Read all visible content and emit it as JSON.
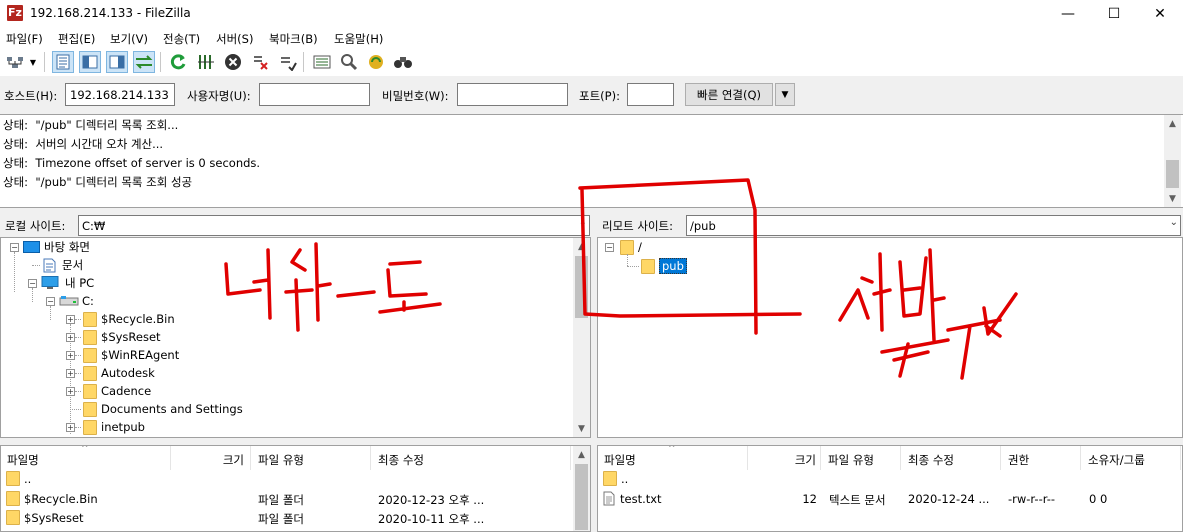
{
  "window": {
    "title": "192.168.214.133 - FileZilla",
    "app_icon": "Fz",
    "controls": {
      "minimize": "—",
      "maximize": "☐",
      "close": "✕"
    }
  },
  "menu": [
    "파일(F)",
    "편집(E)",
    "보기(V)",
    "전송(T)",
    "서버(S)",
    "북마크(B)",
    "도움말(H)"
  ],
  "toolbar": {
    "icons": [
      "site-manager-icon",
      "dropdown-arrow-icon",
      "toggle-log-icon",
      "toggle-local-tree-icon",
      "toggle-remote-tree-icon",
      "toggle-queue-icon",
      "refresh-icon",
      "process-queue-icon",
      "cancel-icon",
      "disconnect-icon",
      "reconnect-icon",
      "filter-icon",
      "compare-icon",
      "sync-browse-icon",
      "search-icon"
    ]
  },
  "quickconnect": {
    "host_label": "호스트(H):",
    "host_value": "192.168.214.133",
    "user_label": "사용자명(U):",
    "user_value": "",
    "pass_label": "비밀번호(W):",
    "pass_value": "",
    "port_label": "포트(P):",
    "port_value": "",
    "button": "빠른 연결(Q)",
    "dropdown": "▼"
  },
  "log": [
    {
      "prefix": "상태:",
      "text": "\"/pub\" 디렉터리 목록 조회..."
    },
    {
      "prefix": "상태:",
      "text": "서버의 시간대 오차 계산..."
    },
    {
      "prefix": "상태:",
      "text": "Timezone offset of server is 0 seconds."
    },
    {
      "prefix": "상태:",
      "text": "\"/pub\" 디렉터리 목록 조회 성공"
    }
  ],
  "local": {
    "site_label": "로컬 사이트:",
    "path": "C:₩",
    "tree": [
      {
        "label": "바탕 화면",
        "icon": "desktop-icon"
      },
      {
        "label": "문서",
        "icon": "document-icon"
      },
      {
        "label": "내 PC",
        "icon": "computer-icon"
      },
      {
        "label": "C:",
        "icon": "drive-icon"
      },
      {
        "label": "$Recycle.Bin",
        "icon": "folder-icon"
      },
      {
        "label": "$SysReset",
        "icon": "folder-icon"
      },
      {
        "label": "$WinREAgent",
        "icon": "folder-icon"
      },
      {
        "label": "Autodesk",
        "icon": "folder-icon"
      },
      {
        "label": "Cadence",
        "icon": "folder-icon"
      },
      {
        "label": "Documents and Settings",
        "icon": "folder-icon"
      },
      {
        "label": "inetpub",
        "icon": "folder-icon"
      }
    ],
    "columns": [
      "파일명",
      "크기",
      "파일 유형",
      "최종 수정"
    ],
    "rows": [
      {
        "name": "..",
        "size": "",
        "type": "",
        "modified": ""
      },
      {
        "name": "$Recycle.Bin",
        "size": "",
        "type": "파일 폴더",
        "modified": "2020-12-23 오후 ..."
      },
      {
        "name": "$SysReset",
        "size": "",
        "type": "파일 폴더",
        "modified": "2020-10-11 오후 ..."
      }
    ]
  },
  "remote": {
    "site_label": "리모트 사이트:",
    "path": "/pub",
    "tree": [
      {
        "label": "/",
        "icon": "folder-icon"
      },
      {
        "label": "pub",
        "icon": "folder-icon"
      }
    ],
    "columns": [
      "파일명",
      "크기",
      "파일 유형",
      "최종 수정",
      "권한",
      "소유자/그룹"
    ],
    "rows": [
      {
        "name": "..",
        "size": "",
        "type": "",
        "modified": "",
        "perm": "",
        "owner": ""
      },
      {
        "name": "test.txt",
        "size": "12",
        "type": "텍스트 문서",
        "modified": "2020-12-24 ...",
        "perm": "-rw-r--r--",
        "owner": "0 0"
      }
    ]
  },
  "colors": {
    "annotation": "#e00000",
    "selection": "#0078d7",
    "folder": "#ffd766"
  }
}
